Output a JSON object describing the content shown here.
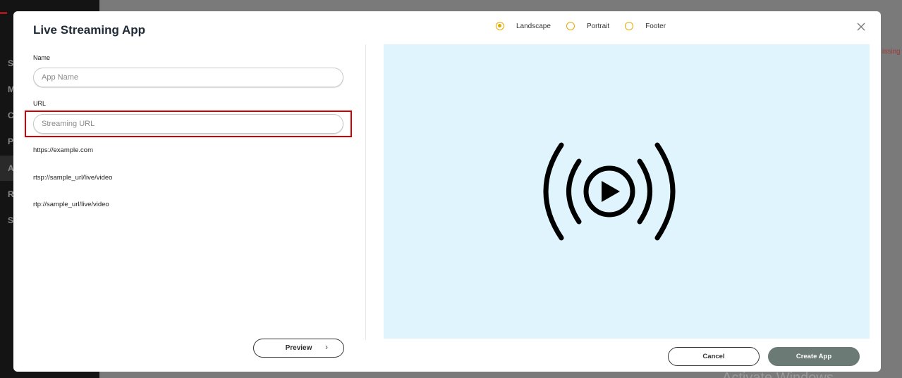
{
  "background": {
    "sidebar_letters": [
      "S",
      "M",
      "C",
      "P",
      "A",
      "R",
      "S"
    ],
    "missing_text": "issing",
    "activate_text": "Activate Windows"
  },
  "modal": {
    "title": "Live Streaming App",
    "orientation": {
      "options": [
        {
          "label": "Landscape",
          "checked": true
        },
        {
          "label": "Portrait",
          "checked": false
        },
        {
          "label": "Footer",
          "checked": false
        }
      ]
    },
    "close_icon": "close-icon",
    "form": {
      "name_label": "Name",
      "name_value": "",
      "name_placeholder": "App Name",
      "url_label": "URL",
      "url_value": "",
      "url_placeholder": "Streaming URL",
      "url_samples": [
        "https://example.com",
        "rtsp://sample_url/live/video",
        "rtp://sample_url/live/video"
      ]
    },
    "preview_button": "Preview",
    "preview_icon": "live-stream-icon",
    "cancel_button": "Cancel",
    "create_button": "Create App"
  },
  "colors": {
    "accent": "#e6a800",
    "highlight": "#d40000",
    "preview_bg": "#dff4fc",
    "create_bg": "#6c7a75"
  }
}
